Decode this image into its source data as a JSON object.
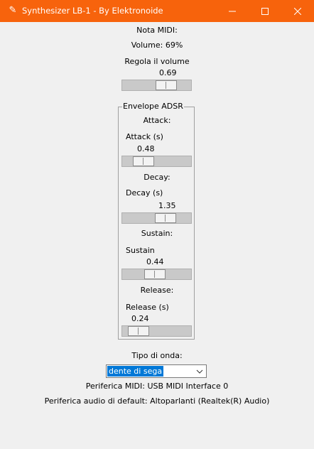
{
  "window": {
    "title": "Synthesizer LB-1 - By Elektronoide",
    "icon": "feather-icon",
    "accent": "#f7630c"
  },
  "midi_note": {
    "label": "Nota MIDI:"
  },
  "volume": {
    "status": "Volume: 69%",
    "label": "Regola il volume",
    "value": "0.69"
  },
  "envelope": {
    "title": "Envelope ADSR",
    "attack": {
      "header": "Attack:",
      "label": "Attack (s)",
      "value": "0.48"
    },
    "decay": {
      "header": "Decay:",
      "label": "Decay (s)",
      "value": "1.35"
    },
    "sustain": {
      "header": "Sustain:",
      "label": "Sustain",
      "value": "0.44"
    },
    "release": {
      "header": "Release:",
      "label": "Release (s)",
      "value": "0.24"
    }
  },
  "waveform": {
    "label": "Tipo di onda:",
    "selected": "dente di sega"
  },
  "devices": {
    "midi": "Periferica MIDI: USB MIDI Interface 0",
    "audio": "Periferica audio di default: Altoparlanti (Realtek(R) Audio)"
  }
}
